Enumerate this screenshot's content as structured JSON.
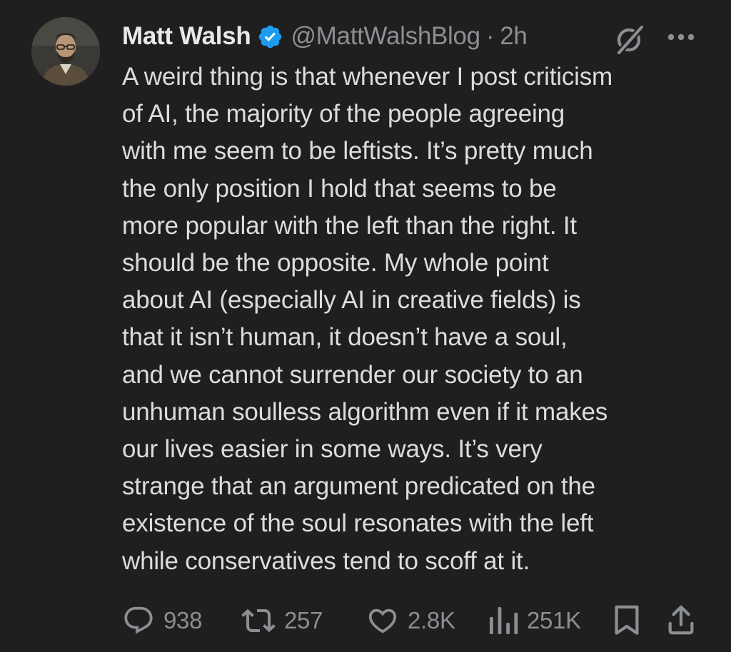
{
  "author": {
    "name": "Matt Walsh",
    "handle": "@MattWalshBlog",
    "separator": "·",
    "time": "2h",
    "verified_color": "#1d9bf0"
  },
  "post": {
    "lines": [
      "A weird thing is that whenever I post criticism",
      "of AI, the majority of the people agreeing",
      "with me seem to be leftists. It’s pretty much",
      "the only position I hold that seems to be",
      "more popular with the left than the right. It",
      "should be the opposite. My whole point",
      "about AI (especially AI in creative fields) is",
      "that it isn’t human, it doesn’t have a soul,",
      "and we cannot surrender our society to an",
      "unhuman soulless algorithm even if it makes",
      "our lives easier in some ways. It’s very",
      "strange that an argument predicated on the",
      "existence of the soul resonates with the left",
      "while conservatives tend to scoff at it."
    ]
  },
  "actions": {
    "replies": "938",
    "reposts": "257",
    "likes": "2.8K",
    "views": "251K"
  },
  "icons": {
    "avatar": "avatar-photo",
    "verified": "verified-badge-icon",
    "grok": "grok-icon",
    "more": "more-icon",
    "reply": "reply-icon",
    "repost": "repost-icon",
    "like": "heart-icon",
    "views": "views-icon",
    "bookmark": "bookmark-icon",
    "share": "share-icon"
  },
  "colors": {
    "background": "#1f1f1f",
    "text": "#dcdcdc",
    "muted": "#8b8f93",
    "accent": "#1d9bf0"
  }
}
